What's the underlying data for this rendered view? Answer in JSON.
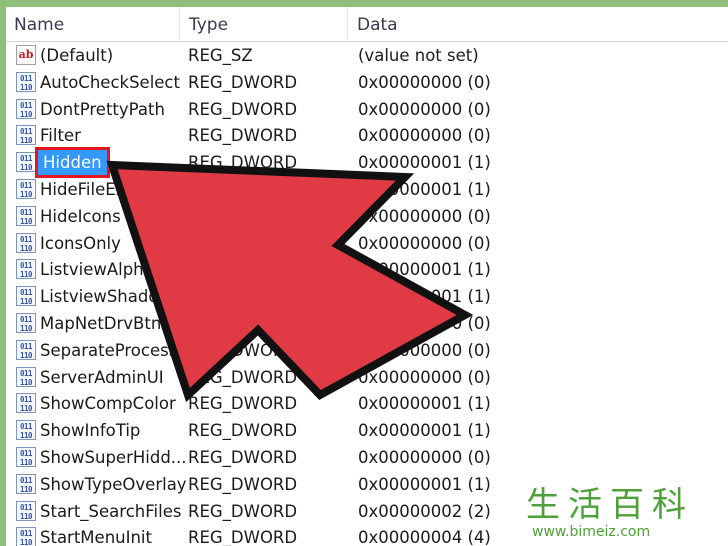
{
  "columns": {
    "name": "Name",
    "type": "Type",
    "data": "Data"
  },
  "rows": [
    {
      "icon": "string-value-icon",
      "name": "(Default)",
      "type": "REG_SZ",
      "data": "(value not set)"
    },
    {
      "icon": "dword-value-icon",
      "name": "AutoCheckSelect",
      "type": "REG_DWORD",
      "data": "0x00000000 (0)"
    },
    {
      "icon": "dword-value-icon",
      "name": "DontPrettyPath",
      "type": "REG_DWORD",
      "data": "0x00000000 (0)"
    },
    {
      "icon": "dword-value-icon",
      "name": "Filter",
      "type": "REG_DWORD",
      "data": "0x00000000 (0)"
    },
    {
      "icon": "dword-value-icon",
      "name": "Hidden",
      "type": "REG_DWORD",
      "data": "0x00000001 (1)",
      "selected": true
    },
    {
      "icon": "dword-value-icon",
      "name": "HideFileExt",
      "type": "REG_DWORD",
      "data": "0x00000001 (1)"
    },
    {
      "icon": "dword-value-icon",
      "name": "HideIcons",
      "type": "REG_DWORD",
      "data": "0x00000000 (0)"
    },
    {
      "icon": "dword-value-icon",
      "name": "IconsOnly",
      "type": "REG_DWORD",
      "data": "0x00000000 (0)"
    },
    {
      "icon": "dword-value-icon",
      "name": "ListviewAlphaSe...",
      "type": "REG_DWORD",
      "data": "0x00000001 (1)"
    },
    {
      "icon": "dword-value-icon",
      "name": "ListviewShadow",
      "type": "REG_DWORD",
      "data": "0x00000001 (1)"
    },
    {
      "icon": "dword-value-icon",
      "name": "MapNetDrvBtn",
      "type": "REG_DWORD",
      "data": "0x00000000 (0)"
    },
    {
      "icon": "dword-value-icon",
      "name": "SeparateProcess",
      "type": "REG_DWORD",
      "data": "0x00000000 (0)"
    },
    {
      "icon": "dword-value-icon",
      "name": "ServerAdminUI",
      "type": "REG_DWORD",
      "data": "0x00000000 (0)"
    },
    {
      "icon": "dword-value-icon",
      "name": "ShowCompColor",
      "type": "REG_DWORD",
      "data": "0x00000001 (1)"
    },
    {
      "icon": "dword-value-icon",
      "name": "ShowInfoTip",
      "type": "REG_DWORD",
      "data": "0x00000001 (1)"
    },
    {
      "icon": "dword-value-icon",
      "name": "ShowSuperHidd...",
      "type": "REG_DWORD",
      "data": "0x00000000 (0)"
    },
    {
      "icon": "dword-value-icon",
      "name": "ShowTypeOverlay",
      "type": "REG_DWORD",
      "data": "0x00000001 (1)"
    },
    {
      "icon": "dword-value-icon",
      "name": "Start_SearchFiles",
      "type": "REG_DWORD",
      "data": "0x00000002 (2)"
    },
    {
      "icon": "dword-value-icon",
      "name": "StartMenuInit",
      "type": "REG_DWORD",
      "data": "0x00000004 (4)"
    }
  ],
  "icons": {
    "string": "ab",
    "dword": "011\n110"
  },
  "colors": {
    "selection": "#3399ff",
    "highlight_box": "#e3161d",
    "arrow": "#e03a44"
  },
  "watermark": {
    "chars": "生活百科",
    "url": "www.bimeiz.com"
  }
}
